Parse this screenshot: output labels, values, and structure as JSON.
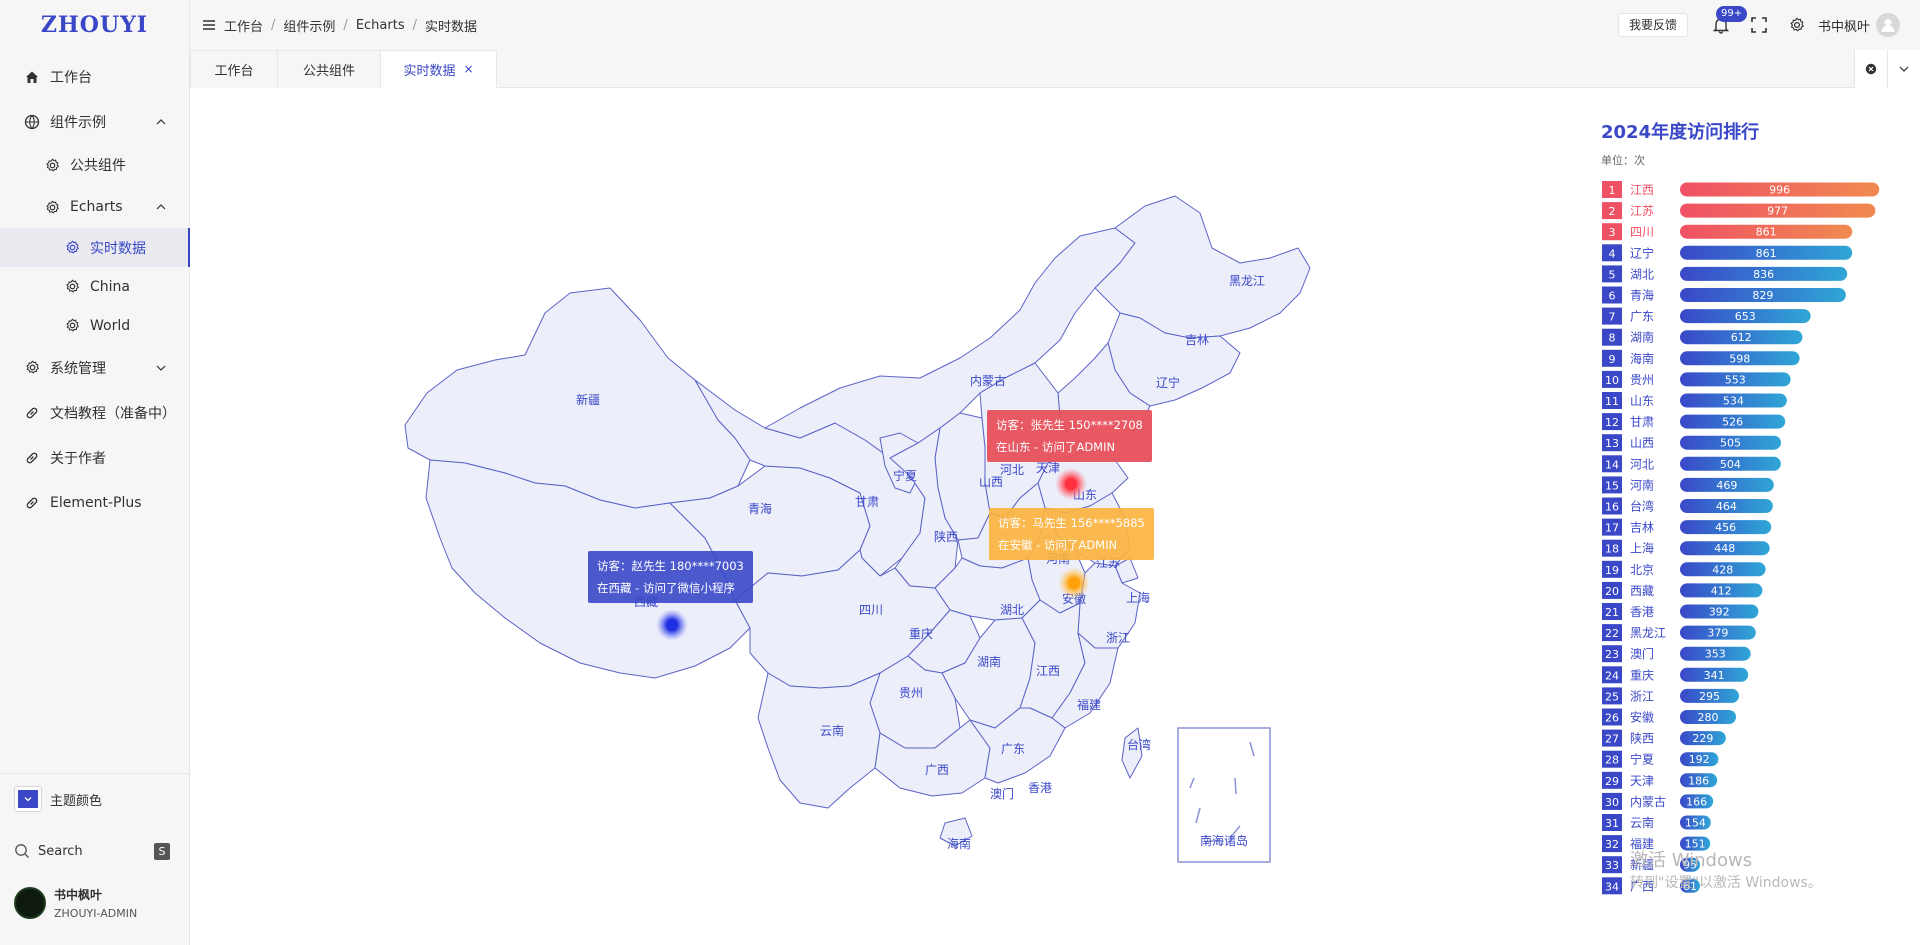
{
  "app": {
    "logo": "ZHOUYI"
  },
  "sidebar": {
    "items": [
      {
        "label": "工作台",
        "icon": "home-icon"
      },
      {
        "label": "组件示例",
        "icon": "basketball-icon"
      },
      {
        "label": "公共组件",
        "icon": "gear-icon"
      },
      {
        "label": "Echarts",
        "icon": "gear-icon"
      },
      {
        "label": "实时数据",
        "icon": "gear-icon"
      },
      {
        "label": "China",
        "icon": "gear-icon"
      },
      {
        "label": "World",
        "icon": "gear-icon"
      },
      {
        "label": "系统管理",
        "icon": "gear-icon"
      },
      {
        "label": "文档教程（准备中）",
        "icon": "link-icon"
      },
      {
        "label": "关于作者",
        "icon": "link-icon"
      },
      {
        "label": "Element-Plus",
        "icon": "link-icon"
      }
    ],
    "theme_label": "主题颜色",
    "search_label": "Search",
    "search_shortcut": "S",
    "user_name": "书中枫叶",
    "user_sub": "ZHOUYI-ADMIN"
  },
  "header": {
    "breadcrumb": [
      "工作台",
      "组件示例",
      "Echarts",
      "实时数据"
    ],
    "feedback": "我要反馈",
    "badge": "99+",
    "user_name": "书中枫叶"
  },
  "tabs": [
    {
      "label": "工作台"
    },
    {
      "label": "公共组件"
    },
    {
      "label": "实时数据",
      "close": "×"
    }
  ],
  "map": {
    "provinces": [
      "新疆",
      "西藏",
      "青海",
      "甘肃",
      "宁夏",
      "内蒙古",
      "黑龙江",
      "吉林",
      "辽宁",
      "山西",
      "陕西",
      "四川",
      "重庆",
      "贵州",
      "云南",
      "广西",
      "广东",
      "香港",
      "澳门",
      "海南",
      "湖南",
      "湖北",
      "河南",
      "江西",
      "福建",
      "浙江",
      "安徽",
      "山东",
      "上海",
      "江苏",
      "台湾",
      "北京",
      "河北",
      "天津",
      "南海诸岛"
    ],
    "tooltips": [
      {
        "line1": "访客：张先生  150****2708",
        "line2": "在山东 - 访问了ADMIN",
        "color": "#e8505b"
      },
      {
        "line1": "访客：马先生  156****5885",
        "line2": "在安徽 - 访问了ADMIN",
        "color": "#fbb33f"
      },
      {
        "line1": "访客：赵先生  180****7003",
        "line2": "在西藏 - 访问了微信小程序",
        "color": "#3a48c8"
      }
    ]
  },
  "ranking": {
    "title": "2024年度访问排行",
    "unit": "单位：次",
    "colors": {
      "top": "#ef5164",
      "normal": "#3a48c8",
      "bar_top_end": "#f08a50",
      "bar_normal_end": "#2fa6d6"
    }
  },
  "chart_data": {
    "type": "bar",
    "title": "2024年度访问排行",
    "unit": "次",
    "categories": [
      "江西",
      "江苏",
      "四川",
      "辽宁",
      "湖北",
      "青海",
      "广东",
      "湖南",
      "海南",
      "贵州",
      "山东",
      "甘肃",
      "山西",
      "河北",
      "河南",
      "台湾",
      "吉林",
      "上海",
      "北京",
      "西藏",
      "香港",
      "黑龙江",
      "澳门",
      "重庆",
      "浙江",
      "安徽",
      "陕西",
      "宁夏",
      "天津",
      "内蒙古",
      "云南",
      "福建",
      "新疆",
      "广西"
    ],
    "values": [
      996,
      977,
      861,
      861,
      836,
      829,
      653,
      612,
      598,
      553,
      534,
      526,
      505,
      504,
      469,
      464,
      456,
      448,
      428,
      412,
      392,
      379,
      353,
      341,
      295,
      280,
      229,
      192,
      186,
      166,
      154,
      151,
      95,
      61
    ],
    "xlim": [
      0,
      1000
    ]
  },
  "watermark": {
    "line1": "激活 Windows",
    "line2": "转到\"设置\"以激活 Windows。"
  }
}
